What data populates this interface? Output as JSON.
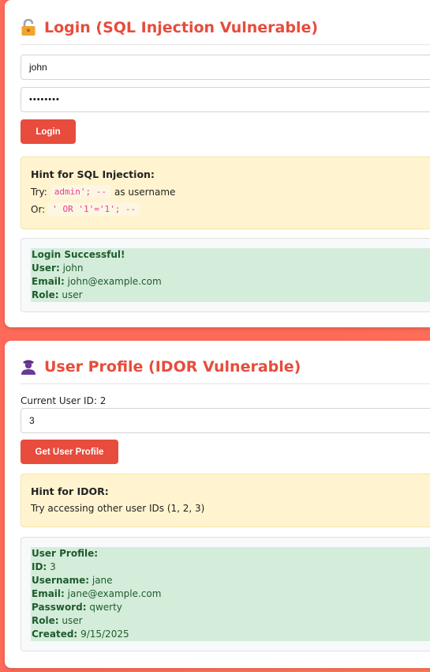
{
  "login": {
    "title": "Login (SQL Injection Vulnerable)",
    "icon": "lock-icon",
    "username_value": "john",
    "password_value": "••••••••",
    "button_label": "Login",
    "hint": {
      "title": "Hint for SQL Injection:",
      "try_label": "Try:",
      "try_code": "admin'; --",
      "try_suffix": "as username",
      "or_label": "Or:",
      "or_code": "' OR '1'='1'; --"
    },
    "result": {
      "heading": "Login Successful!",
      "user_label": "User:",
      "user_value": "john",
      "email_label": "Email:",
      "email_value": "john@example.com",
      "role_label": "Role:",
      "role_value": "user"
    }
  },
  "profile": {
    "title": "User Profile (IDOR Vulnerable)",
    "icon": "user-icon",
    "current_user_text": "Current User ID: 2",
    "user_id_value": "3",
    "button_label": "Get User Profile",
    "hint": {
      "title": "Hint for IDOR:",
      "text": "Try accessing other user IDs (1, 2, 3)"
    },
    "result": {
      "heading": "User Profile:",
      "id_label": "ID:",
      "id_value": "3",
      "username_label": "Username:",
      "username_value": "jane",
      "email_label": "Email:",
      "email_value": "jane@example.com",
      "password_label": "Password:",
      "password_value": "qwerty",
      "role_label": "Role:",
      "role_value": "user",
      "created_label": "Created:",
      "created_value": "9/15/2025"
    }
  },
  "colors": {
    "accent": "#e74c3c",
    "background": "#ff6b5b",
    "hint_bg": "#fff4cf",
    "success_bg": "#d4edda",
    "success_text": "#1f5b2e"
  }
}
